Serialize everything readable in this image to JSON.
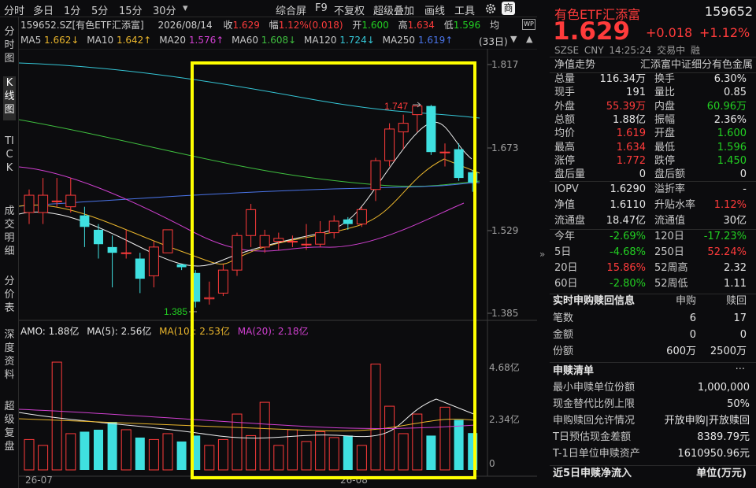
{
  "toolbar": {
    "left_items": [
      "分时",
      "多日",
      "1分",
      "5分",
      "15分",
      "30分"
    ],
    "dropdown_glyph": "▾",
    "right_items": [
      "综合屏",
      "F9",
      "不复权",
      "超级叠加",
      "画线",
      "工具"
    ],
    "settings_icon": "gear-icon",
    "shop_label": "商"
  },
  "side_nav": [
    {
      "label": "分时图",
      "active": false
    },
    {
      "label": "K线图",
      "active": true
    },
    {
      "label": "TICK",
      "active": false
    },
    {
      "label": "成交明细",
      "active": false
    },
    {
      "label": "分价表",
      "active": false
    },
    {
      "label": "深度资料",
      "active": false
    },
    {
      "label": "超级复盘",
      "active": false
    }
  ],
  "info_line": {
    "code": "159652.SZ[有色ETF汇添富]",
    "date": "2026/08/14",
    "close_label": "收",
    "close": "1.629",
    "range_label": "幅",
    "range": "1.12%(0.018)",
    "open_label": "开",
    "open": "1.600",
    "high_label": "高",
    "high": "1.634",
    "low_label": "低",
    "low": "1.596",
    "avg_label": "均",
    "wp_badge": "WP"
  },
  "ma_line": [
    {
      "name": "MA5",
      "value": "1.662↓",
      "color": "#f0f0f0"
    },
    {
      "name": "MA10",
      "value": "1.642↑",
      "color": "#e9b52c"
    },
    {
      "name": "MA20",
      "value": "1.576↑",
      "color": "#d040d0"
    },
    {
      "name": "MA60",
      "value": "1.608↓",
      "color": "#3fbf3f"
    },
    {
      "name": "MA120",
      "value": "1.724↓",
      "color": "#35c6d6"
    },
    {
      "name": "MA250",
      "value": "1.619↑",
      "color": "#4a74e8"
    }
  ],
  "period_label": "(33日)",
  "price_axis": [
    "1.817",
    "1.673",
    "1.529",
    "1.385"
  ],
  "annotations": {
    "high_label": "1.747",
    "low_label": "1.385"
  },
  "vol_legend": {
    "amo": "AMO: 1.88亿",
    "ma5": "MA(5): 2.56亿",
    "ma10": "MA(10): 2.53亿",
    "ma20": "MA(20): 2.18亿"
  },
  "vol_axis": [
    "4.68亿",
    "2.34亿",
    "0"
  ],
  "x_axis": [
    "26-07",
    "26-08"
  ],
  "chart_data": {
    "type": "candlestick",
    "title": "159652.SZ[有色ETF汇添富]",
    "ylim": [
      1.385,
      1.817
    ],
    "candles": [
      {
        "o": 1.56,
        "h": 1.6,
        "l": 1.54,
        "c": 1.59
      },
      {
        "o": 1.56,
        "h": 1.62,
        "l": 1.54,
        "c": 1.59
      },
      {
        "o": 1.58,
        "h": 1.62,
        "l": 1.57,
        "c": 1.58
      },
      {
        "o": 1.57,
        "h": 1.62,
        "l": 1.56,
        "c": 1.59
      },
      {
        "o": 1.555,
        "h": 1.57,
        "l": 1.5,
        "c": 1.535
      },
      {
        "o": 1.53,
        "h": 1.54,
        "l": 1.48,
        "c": 1.505
      },
      {
        "o": 1.5,
        "h": 1.52,
        "l": 1.43,
        "c": 1.49
      },
      {
        "o": 1.49,
        "h": 1.53,
        "l": 1.48,
        "c": 1.49
      },
      {
        "o": 1.48,
        "h": 1.49,
        "l": 1.42,
        "c": 1.445
      },
      {
        "o": 1.45,
        "h": 1.51,
        "l": 1.43,
        "c": 1.5
      },
      {
        "o": 1.49,
        "h": 1.53,
        "l": 1.49,
        "c": 1.53
      },
      {
        "o": 1.47,
        "h": 1.47,
        "l": 1.46,
        "c": 1.465
      },
      {
        "o": 1.455,
        "h": 1.46,
        "l": 1.395,
        "c": 1.405
      },
      {
        "o": 1.41,
        "h": 1.44,
        "l": 1.4,
        "c": 1.412
      },
      {
        "o": 1.42,
        "h": 1.47,
        "l": 1.415,
        "c": 1.46
      },
      {
        "o": 1.46,
        "h": 1.525,
        "l": 1.45,
        "c": 1.52
      },
      {
        "o": 1.52,
        "h": 1.575,
        "l": 1.5,
        "c": 1.565
      },
      {
        "o": 1.5,
        "h": 1.53,
        "l": 1.49,
        "c": 1.52
      },
      {
        "o": 1.51,
        "h": 1.525,
        "l": 1.495,
        "c": 1.515
      },
      {
        "o": 1.51,
        "h": 1.52,
        "l": 1.5,
        "c": 1.51
      },
      {
        "o": 1.505,
        "h": 1.54,
        "l": 1.495,
        "c": 1.505
      },
      {
        "o": 1.505,
        "h": 1.545,
        "l": 1.5,
        "c": 1.525
      },
      {
        "o": 1.525,
        "h": 1.555,
        "l": 1.515,
        "c": 1.545
      },
      {
        "o": 1.548,
        "h": 1.552,
        "l": 1.53,
        "c": 1.54
      },
      {
        "o": 1.54,
        "h": 1.57,
        "l": 1.535,
        "c": 1.565
      },
      {
        "o": 1.6,
        "h": 1.655,
        "l": 1.58,
        "c": 1.65
      },
      {
        "o": 1.65,
        "h": 1.715,
        "l": 1.64,
        "c": 1.705
      },
      {
        "o": 1.7,
        "h": 1.73,
        "l": 1.67,
        "c": 1.715
      },
      {
        "o": 1.73,
        "h": 1.74,
        "l": 1.7,
        "c": 1.745
      },
      {
        "o": 1.745,
        "h": 1.747,
        "l": 1.66,
        "c": 1.665
      },
      {
        "o": 1.665,
        "h": 1.68,
        "l": 1.64,
        "c": 1.665
      },
      {
        "o": 1.67,
        "h": 1.68,
        "l": 1.615,
        "c": 1.62
      },
      {
        "o": 1.63,
        "h": 1.634,
        "l": 1.596,
        "c": 1.612
      }
    ],
    "volume_unit": "亿",
    "volume": [
      1.55,
      1.25,
      5.5,
      1.85,
      1.95,
      2.05,
      2.45,
      2.05,
      1.65,
      1.55,
      1.85,
      1.45,
      1.75,
      1.25,
      1.55,
      2.85,
      1.75,
      3.45,
      1.25,
      2.05,
      1.45,
      1.95,
      1.65,
      1.75,
      1.25,
      5.4,
      3.25,
      1.85,
      2.85,
      1.75,
      3.2,
      2.55,
      1.88
    ]
  },
  "highlight_box": {
    "color": "#ffff00"
  },
  "right_panel": {
    "name": "有色ETF汇添富",
    "code": "159652",
    "price": "1.629",
    "change": "+0.018",
    "change_pct": "+1.12%",
    "market": "SZSE",
    "currency": "CNY",
    "time": "14:25:24",
    "status": "交易中",
    "margin": "融",
    "trend_label": "净值走势",
    "index_name": "汇添富中证细分有色金属",
    "quote_rows": [
      [
        {
          "k": "总量",
          "v": "116.34万",
          "c": "white"
        },
        {
          "k": "换手",
          "v": "6.30%",
          "c": "white"
        }
      ],
      [
        {
          "k": "现手",
          "v": "191",
          "c": "white"
        },
        {
          "k": "量比",
          "v": "0.85",
          "c": "white"
        }
      ],
      [
        {
          "k": "外盘",
          "v": "55.39万",
          "c": "red"
        },
        {
          "k": "内盘",
          "v": "60.96万",
          "c": "green"
        }
      ],
      [
        {
          "k": "总额",
          "v": "1.88亿",
          "c": "white"
        },
        {
          "k": "振幅",
          "v": "2.36%",
          "c": "white"
        }
      ],
      [
        {
          "k": "均价",
          "v": "1.619",
          "c": "red"
        },
        {
          "k": "开盘",
          "v": "1.600",
          "c": "green"
        }
      ],
      [
        {
          "k": "最高",
          "v": "1.634",
          "c": "red"
        },
        {
          "k": "最低",
          "v": "1.596",
          "c": "green"
        }
      ],
      [
        {
          "k": "涨停",
          "v": "1.772",
          "c": "red"
        },
        {
          "k": "跌停",
          "v": "1.450",
          "c": "green"
        }
      ],
      [
        {
          "k": "盘后量",
          "v": "0",
          "c": "white"
        },
        {
          "k": "盘后额",
          "v": "0",
          "c": "white"
        }
      ]
    ],
    "iopv_rows": [
      [
        {
          "k": "IOPV",
          "v": "1.6290",
          "c": "white"
        },
        {
          "k": "溢折率",
          "v": "-",
          "c": "white"
        }
      ],
      [
        {
          "k": "净值",
          "v": "1.6110",
          "c": "white"
        },
        {
          "k": "升贴水率",
          "v": "1.12%",
          "c": "red"
        }
      ],
      [
        {
          "k": "流通盘",
          "v": "18.47亿",
          "c": "white"
        },
        {
          "k": "流通值",
          "v": "30亿",
          "c": "white"
        }
      ]
    ],
    "perf_rows": [
      [
        {
          "k": "今年",
          "v": "-2.69%",
          "c": "green"
        },
        {
          "k": "120日",
          "v": "-17.23%",
          "c": "green"
        }
      ],
      [
        {
          "k": "5日",
          "v": "-4.68%",
          "c": "green"
        },
        {
          "k": "250日",
          "v": "52.24%",
          "c": "red"
        }
      ],
      [
        {
          "k": "20日",
          "v": "15.86%",
          "c": "red"
        },
        {
          "k": "52周高",
          "v": "2.32",
          "c": "white"
        }
      ],
      [
        {
          "k": "60日",
          "v": "-2.80%",
          "c": "green"
        },
        {
          "k": "52周低",
          "v": "1.11",
          "c": "white"
        }
      ]
    ],
    "sr_title": "实时申购赎回信息",
    "sr_head": [
      "申购",
      "赎回"
    ],
    "sr_rows": [
      {
        "k": "笔数",
        "a": "6",
        "b": "17"
      },
      {
        "k": "金额",
        "a": "0",
        "b": "0"
      },
      {
        "k": "份额",
        "a": "600万",
        "b": "2500万"
      }
    ],
    "list_title": "申赎清单",
    "list_more": "···",
    "list_rows": [
      {
        "k": "最小申赎单位份额",
        "v": "1,000,000"
      },
      {
        "k": "现金替代比例上限",
        "v": "50%"
      },
      {
        "k": "申购赎回允许情况",
        "v": "开放申购|开放赎回"
      },
      {
        "k": "T日预估现金差额",
        "v": "8389.79元"
      },
      {
        "k": "T-1日单位申赎资产",
        "v": "1610950.96元"
      }
    ],
    "footer_left": "近5日申赎净流入",
    "footer_right": "单位(万元)",
    "collapse_glyph": "»"
  }
}
